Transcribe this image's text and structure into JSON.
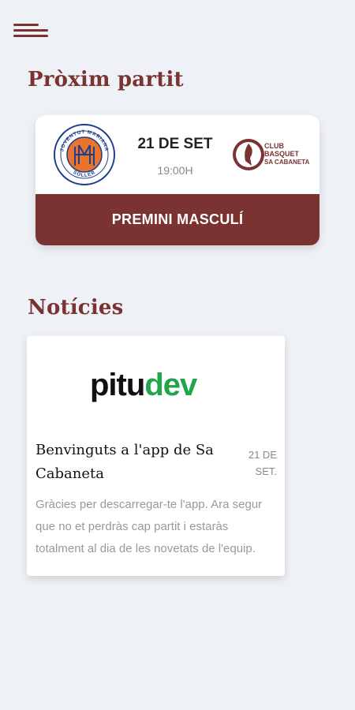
{
  "header": {
    "menu_icon": "hamburger-menu-icon"
  },
  "next_match": {
    "section_title": "Pròxim partit",
    "home_team": {
      "logo_icon": "joventut-mariana-crest-icon",
      "logo_text": "JOVENTUT MARIANA SÓLLER",
      "colors": {
        "primary": "#1d3f8c",
        "accent": "#e8742d"
      }
    },
    "away_team": {
      "logo_icon": "club-basquet-sa-cabaneta-crest-icon",
      "logo_lines": [
        "CLUB",
        "BASQUET",
        "SA CABANETA"
      ],
      "colors": {
        "primary": "#7a3331"
      }
    },
    "date": "21 DE SET",
    "time": "19:00H",
    "competition": "PREMINI MASCULÍ"
  },
  "news": {
    "section_title": "Notícies",
    "items": [
      {
        "brand_logo_part1": "pitu",
        "brand_logo_part2": "dev",
        "title": "Benvinguts a l'app de Sa Cabaneta",
        "date_line1": "21 DE",
        "date_line2": "SET.",
        "excerpt": "Gràcies per descarregar-te l'app. Ara segur que no et perdràs cap partit i estaràs totalment al dia de les novetats de l'equip."
      }
    ]
  },
  "colors": {
    "accent": "#7a3331",
    "background": "#eef1f5",
    "brand_green": "#21a44a"
  }
}
